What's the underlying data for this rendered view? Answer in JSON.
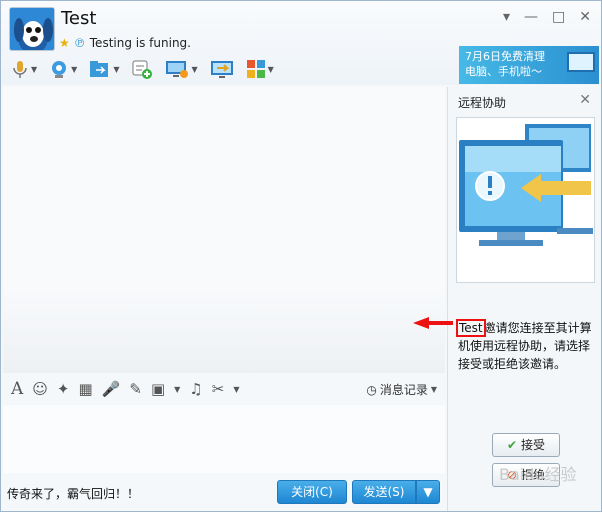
{
  "window": {
    "title": "Test",
    "status": "Testing is funing."
  },
  "window_buttons": [
    "▾",
    "—",
    "□",
    "✕"
  ],
  "ad": {
    "line1": "7月6日免费清理",
    "line2": "电脑、手机啦～"
  },
  "toolbar": {
    "icons": [
      "microphone-icon",
      "webcam-icon",
      "file-transfer-icon",
      "new-chat-icon",
      "screen-share-icon",
      "remote-assist-icon",
      "apps-icon"
    ]
  },
  "format_toolbar": {
    "icons": [
      "A",
      "☺",
      "✦",
      "▦",
      "🎤",
      "✎",
      "▣",
      "♫",
      "✂"
    ],
    "history_label": "消息记录"
  },
  "input": {
    "text": "传奇来了，霸气回归！！"
  },
  "buttons": {
    "close": "关闭(C)",
    "send": "发送(S)"
  },
  "side": {
    "title": "远程协助",
    "inviter": "Test",
    "message": "邀请您连接至其计算机使用远程协助，请选择接受或拒绝该邀请。",
    "accept": "接受",
    "reject": "拒绝"
  },
  "watermark": "Baidu经验",
  "colors": {
    "accent": "#1e87d3",
    "highlight": "#e11111"
  }
}
